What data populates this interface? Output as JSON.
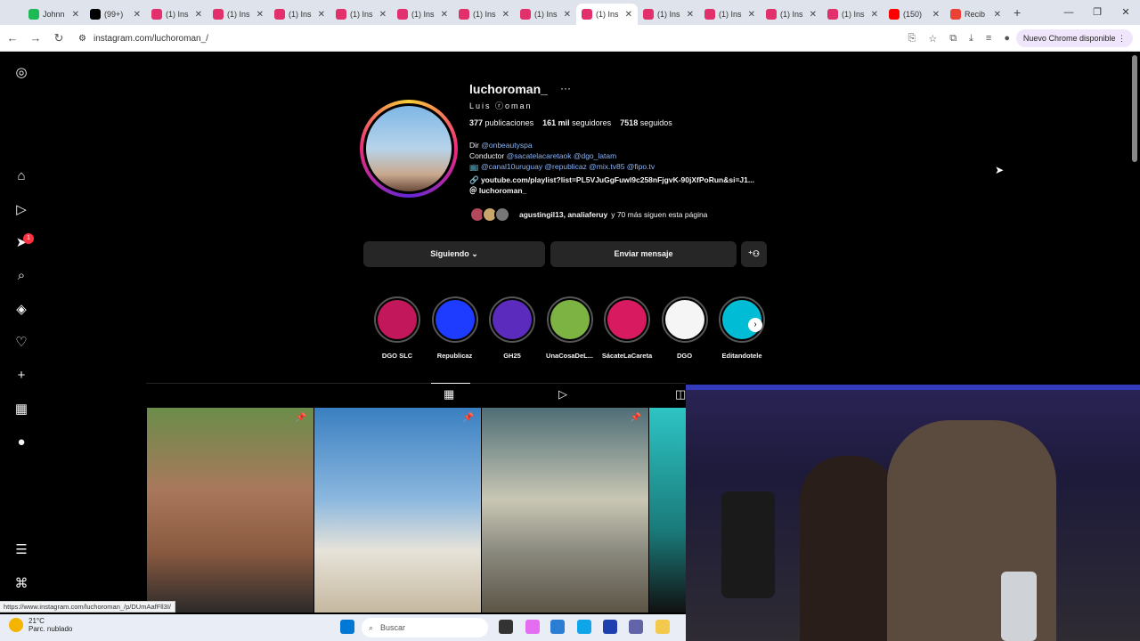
{
  "browser": {
    "tabs": [
      {
        "label": "Johnn",
        "favicon_color": "#1db954"
      },
      {
        "label": "(99+)",
        "favicon_color": "#000000"
      },
      {
        "label": "(1) Ins",
        "favicon_color": "#e1306c"
      },
      {
        "label": "(1) Ins",
        "favicon_color": "#e1306c"
      },
      {
        "label": "(1) Ins",
        "favicon_color": "#e1306c"
      },
      {
        "label": "(1) Ins",
        "favicon_color": "#e1306c"
      },
      {
        "label": "(1) Ins",
        "favicon_color": "#e1306c"
      },
      {
        "label": "(1) Ins",
        "favicon_color": "#e1306c"
      },
      {
        "label": "(1) Ins",
        "favicon_color": "#e1306c"
      },
      {
        "label": "(1) Ins",
        "favicon_color": "#e1306c",
        "active": true
      },
      {
        "label": "(1) Ins",
        "favicon_color": "#e1306c"
      },
      {
        "label": "(1) Ins",
        "favicon_color": "#e1306c"
      },
      {
        "label": "(1) Ins",
        "favicon_color": "#e1306c"
      },
      {
        "label": "(1) Ins",
        "favicon_color": "#e1306c"
      },
      {
        "label": "(150)",
        "favicon_color": "#ff0000"
      },
      {
        "label": "Recib",
        "favicon_color": "#ea4335"
      }
    ],
    "url": "instagram.com/luchoroman_/",
    "update_label": "Nuevo Chrome disponible",
    "status_url": "https://www.instagram.com/luchoroman_/p/DUmAafFll3I/"
  },
  "profile": {
    "username": "luchoroman_",
    "full_name": "Luis ⓡoman",
    "posts_count": "377",
    "posts_label": "publicaciones",
    "followers_count": "161 mil",
    "followers_label": "seguidores",
    "following_count": "7518",
    "following_label": "seguidos",
    "bio": {
      "line1_prefix": "Dir ",
      "line1_link": "@onbeautyspa",
      "line2_prefix": "Conductor ",
      "line2_link": "@sacatelacaretaok @dgo_latam",
      "line3": "📺 @canal10uruguay @republicaz @mix.tv85 @fipo.tv",
      "link": "youtube.com/playlist?list=PL5VJuGgFuwl9c258nFjgvK-90jXfPoRun&si=J1...",
      "threads": "luchoroman_"
    },
    "mutual_names": "agustingil13, analiaferuy",
    "mutual_suffix": " y 70 más siguen esta página"
  },
  "actions": {
    "following_label": "Siguiendo",
    "message_label": "Enviar mensaje"
  },
  "highlights": [
    {
      "label": "DGO SLC",
      "color": "#c2185b"
    },
    {
      "label": "Republicaz",
      "color": "#1e3cff"
    },
    {
      "label": "GH25",
      "color": "#5b2bbd"
    },
    {
      "label": "UnaCosaDeL...",
      "color": "#7cb342"
    },
    {
      "label": "SácateLaCareta",
      "color": "#d81b60"
    },
    {
      "label": "DGO",
      "color": "#f5f5f5"
    },
    {
      "label": "Editandotele",
      "color": "#00bcd4"
    }
  ],
  "taskbar": {
    "temp": "21°C",
    "weather": "Parc. nublado",
    "search_label": "Buscar"
  }
}
